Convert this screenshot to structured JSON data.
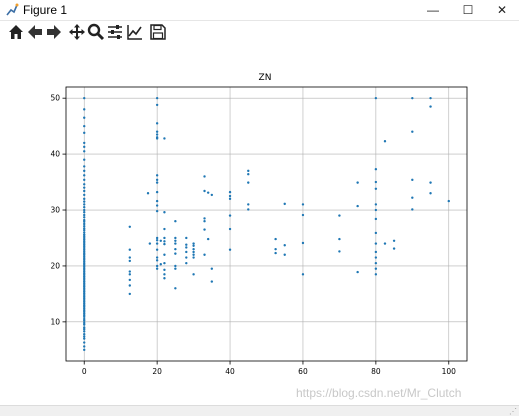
{
  "window": {
    "title": "Figure 1",
    "minimize_glyph": "—",
    "maximize_glyph": "☐",
    "close_glyph": "✕"
  },
  "toolbar": {
    "icons": [
      "home-icon",
      "back-icon",
      "forward-icon",
      "pan-icon",
      "zoom-icon",
      "configure-subplots-icon",
      "edit-axis-icon",
      "save-icon"
    ]
  },
  "watermark": "https://blog.csdn.net/Mr_Clutch",
  "colors": {
    "point": "#1f77b4",
    "grid": "#b0b0b0",
    "axis": "#000000"
  },
  "chart_data": {
    "type": "scatter",
    "title": "ZN",
    "xlabel": "",
    "ylabel": "",
    "xlim": [
      -5,
      105
    ],
    "ylim": [
      3,
      52
    ],
    "xticks": [
      0,
      20,
      40,
      60,
      80,
      100
    ],
    "yticks": [
      10,
      20,
      30,
      40,
      50
    ],
    "grid": true,
    "points": [
      [
        0,
        50
      ],
      [
        0,
        48
      ],
      [
        0,
        46.5
      ],
      [
        0,
        45
      ],
      [
        0,
        43.8
      ],
      [
        0,
        42
      ],
      [
        0,
        41.3
      ],
      [
        0,
        40.5
      ],
      [
        0,
        39
      ],
      [
        0,
        37.8
      ],
      [
        0,
        37
      ],
      [
        0,
        36.2
      ],
      [
        0,
        35.4
      ],
      [
        0,
        34.6
      ],
      [
        0,
        34
      ],
      [
        0,
        33.4
      ],
      [
        0,
        32.7
      ],
      [
        0,
        32
      ],
      [
        0,
        31.5
      ],
      [
        0,
        31
      ],
      [
        0,
        30.5
      ],
      [
        0,
        30
      ],
      [
        0,
        29.6
      ],
      [
        0,
        29.1
      ],
      [
        0,
        28.7
      ],
      [
        0,
        28.2
      ],
      [
        0,
        27.9
      ],
      [
        0,
        27.5
      ],
      [
        0,
        27.1
      ],
      [
        0,
        26.7
      ],
      [
        0,
        26.4
      ],
      [
        0,
        26
      ],
      [
        0,
        25.6
      ],
      [
        0,
        25.3
      ],
      [
        0,
        25
      ],
      [
        0,
        24.7
      ],
      [
        0,
        24.4
      ],
      [
        0,
        24.1
      ],
      [
        0,
        23.8
      ],
      [
        0,
        23.5
      ],
      [
        0,
        23.2
      ],
      [
        0,
        22.9
      ],
      [
        0,
        22.6
      ],
      [
        0,
        22.3
      ],
      [
        0,
        22
      ],
      [
        0,
        21.7
      ],
      [
        0,
        21.4
      ],
      [
        0,
        21.1
      ],
      [
        0,
        20.8
      ],
      [
        0,
        20.5
      ],
      [
        0,
        20.2
      ],
      [
        0,
        19.9
      ],
      [
        0,
        19.6
      ],
      [
        0,
        19.3
      ],
      [
        0,
        19
      ],
      [
        0,
        18.7
      ],
      [
        0,
        18.4
      ],
      [
        0,
        18.1
      ],
      [
        0,
        17.8
      ],
      [
        0,
        17.5
      ],
      [
        0,
        17.2
      ],
      [
        0,
        16.9
      ],
      [
        0,
        16.6
      ],
      [
        0,
        16.3
      ],
      [
        0,
        16
      ],
      [
        0,
        15.7
      ],
      [
        0,
        15.4
      ],
      [
        0,
        15.1
      ],
      [
        0,
        14.8
      ],
      [
        0,
        14.5
      ],
      [
        0,
        14.2
      ],
      [
        0,
        13.9
      ],
      [
        0,
        13.6
      ],
      [
        0,
        13.3
      ],
      [
        0,
        13
      ],
      [
        0,
        12.7
      ],
      [
        0,
        12.4
      ],
      [
        0,
        12.1
      ],
      [
        0,
        11.8
      ],
      [
        0,
        11.5
      ],
      [
        0,
        11.2
      ],
      [
        0,
        10.9
      ],
      [
        0,
        10.5
      ],
      [
        0,
        10.2
      ],
      [
        0,
        9.8
      ],
      [
        0,
        9.5
      ],
      [
        0,
        9
      ],
      [
        0,
        8.7
      ],
      [
        0,
        8.3
      ],
      [
        0,
        7.8
      ],
      [
        0,
        7.4
      ],
      [
        0,
        7
      ],
      [
        0,
        6.3
      ],
      [
        0,
        5.6
      ],
      [
        0,
        5
      ],
      [
        12.5,
        27
      ],
      [
        12.5,
        22.9
      ],
      [
        12.5,
        21.5
      ],
      [
        12.5,
        20.9
      ],
      [
        12.5,
        19
      ],
      [
        12.5,
        18.5
      ],
      [
        12.5,
        17.5
      ],
      [
        12.5,
        16.5
      ],
      [
        12.5,
        15
      ],
      [
        17.5,
        33
      ],
      [
        18,
        24
      ],
      [
        20,
        50
      ],
      [
        20,
        48.8
      ],
      [
        20,
        45.5
      ],
      [
        20,
        44
      ],
      [
        20,
        43.5
      ],
      [
        20,
        43
      ],
      [
        20,
        42.8
      ],
      [
        20,
        36.2
      ],
      [
        20,
        35.4
      ],
      [
        20,
        34.9
      ],
      [
        20,
        33.2
      ],
      [
        20,
        31.6
      ],
      [
        20,
        30.8
      ],
      [
        20,
        29.8
      ],
      [
        20,
        25
      ],
      [
        20,
        24.6
      ],
      [
        20,
        24
      ],
      [
        20,
        22.9
      ],
      [
        20,
        21.5
      ],
      [
        20,
        21
      ],
      [
        20,
        20
      ],
      [
        20,
        19.5
      ],
      [
        21,
        24.5
      ],
      [
        21,
        20.3
      ],
      [
        22,
        42.8
      ],
      [
        22,
        29.6
      ],
      [
        22,
        26.6
      ],
      [
        22,
        25
      ],
      [
        22,
        24.4
      ],
      [
        22,
        23.9
      ],
      [
        22,
        22
      ],
      [
        22,
        20.5
      ],
      [
        22,
        19.3
      ],
      [
        22,
        18.5
      ],
      [
        22,
        17.8
      ],
      [
        25,
        28
      ],
      [
        25,
        25
      ],
      [
        25,
        24.5
      ],
      [
        25,
        24
      ],
      [
        25,
        23
      ],
      [
        25,
        22.2
      ],
      [
        25,
        20
      ],
      [
        25,
        19.5
      ],
      [
        25,
        16
      ],
      [
        28,
        25
      ],
      [
        28,
        23.8
      ],
      [
        28,
        23.3
      ],
      [
        28,
        22.5
      ],
      [
        28,
        21.5
      ],
      [
        28,
        20.5
      ],
      [
        30,
        24
      ],
      [
        30,
        23.6
      ],
      [
        30,
        23
      ],
      [
        30,
        22.5
      ],
      [
        30,
        22
      ],
      [
        30,
        21.5
      ],
      [
        30,
        18.5
      ],
      [
        33,
        36
      ],
      [
        33,
        33.4
      ],
      [
        33,
        28.5
      ],
      [
        33,
        28
      ],
      [
        33,
        26.5
      ],
      [
        33,
        22
      ],
      [
        34,
        33.1
      ],
      [
        34,
        24.8
      ],
      [
        35,
        32.7
      ],
      [
        35,
        19.5
      ],
      [
        35,
        17.2
      ],
      [
        40,
        33.2
      ],
      [
        40,
        32.5
      ],
      [
        40,
        32
      ],
      [
        40,
        29
      ],
      [
        40,
        26.6
      ],
      [
        40,
        22.9
      ],
      [
        45,
        37
      ],
      [
        45,
        36.4
      ],
      [
        45,
        34.9
      ],
      [
        45,
        31
      ],
      [
        45,
        30.1
      ],
      [
        52.5,
        24.8
      ],
      [
        52.5,
        23
      ],
      [
        52.5,
        22.3
      ],
      [
        55,
        31.1
      ],
      [
        55,
        23.7
      ],
      [
        55,
        22
      ],
      [
        60,
        31
      ],
      [
        60,
        29.1
      ],
      [
        60,
        24.1
      ],
      [
        60,
        18.5
      ],
      [
        70,
        29
      ],
      [
        70,
        24.8
      ],
      [
        70,
        22.6
      ],
      [
        75,
        34.9
      ],
      [
        75,
        30.7
      ],
      [
        75,
        18.9
      ],
      [
        80,
        50
      ],
      [
        80,
        37.3
      ],
      [
        80,
        35
      ],
      [
        80,
        33.8
      ],
      [
        80,
        31
      ],
      [
        80,
        30
      ],
      [
        80,
        28.4
      ],
      [
        80,
        25.9
      ],
      [
        80,
        24
      ],
      [
        80,
        22.5
      ],
      [
        80,
        21.5
      ],
      [
        80,
        20.5
      ],
      [
        80,
        19.5
      ],
      [
        80,
        18.5
      ],
      [
        82.5,
        42.3
      ],
      [
        82.5,
        24
      ],
      [
        85,
        24.5
      ],
      [
        85,
        23.1
      ],
      [
        90,
        50
      ],
      [
        90,
        44
      ],
      [
        90,
        35.4
      ],
      [
        90,
        32.2
      ],
      [
        90,
        30.1
      ],
      [
        95,
        50
      ],
      [
        95,
        48.5
      ],
      [
        95,
        34.9
      ],
      [
        95,
        33
      ],
      [
        100,
        31.6
      ]
    ]
  }
}
